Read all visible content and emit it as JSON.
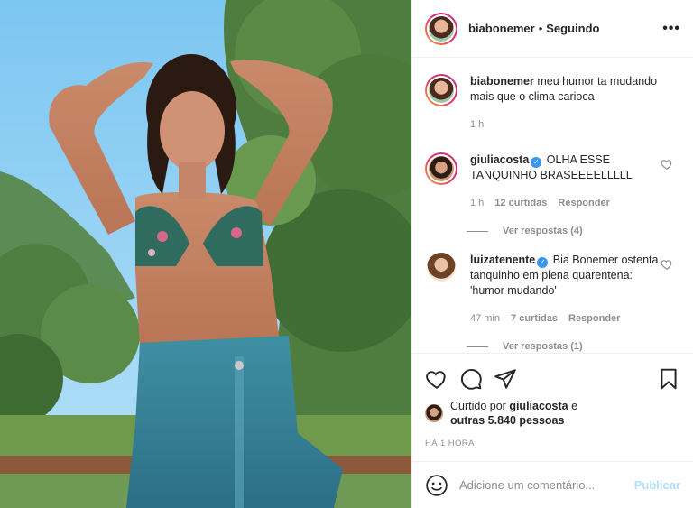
{
  "post": {
    "author": {
      "username": "biabonemer",
      "dot": "•",
      "follow_status": "Seguindo",
      "more_icon": "more-horizontal-icon"
    },
    "caption": {
      "username": "biabonemer",
      "text": "meu humor ta mudando mais que o clima carioca",
      "time": "1 h"
    },
    "comments": [
      {
        "username": "giuliacosta",
        "verified": true,
        "text": "OLHA ESSE TANQUINHO BRASEEEELLLLL",
        "time": "1 h",
        "likes": "12 curtidas",
        "reply_label": "Responder",
        "view_replies": "Ver respostas (4)"
      },
      {
        "username": "luizatenente",
        "verified": true,
        "text": "Bia Bonemer ostenta tanquinho em plena quarentena: 'humor mudando'",
        "time": "47 min",
        "likes": "7 curtidas",
        "reply_label": "Responder",
        "view_replies": "Ver respostas (1)"
      }
    ],
    "likes_summary": {
      "prefix": "Curtido por",
      "user": "giuliacosta",
      "conj": "e",
      "others": "outras 5.840 pessoas"
    },
    "posted_ago": "HÁ 1 HORA",
    "comment_box": {
      "placeholder": "Adicione um comentário...",
      "publish_label": "Publicar"
    },
    "icons": [
      "heart-icon",
      "comment-icon",
      "share-icon",
      "save-icon",
      "emoji-icon"
    ],
    "colors": {
      "verified": "#3897f0",
      "publish_disabled": "#b2dffc",
      "muted": "#8e8e8e"
    }
  }
}
